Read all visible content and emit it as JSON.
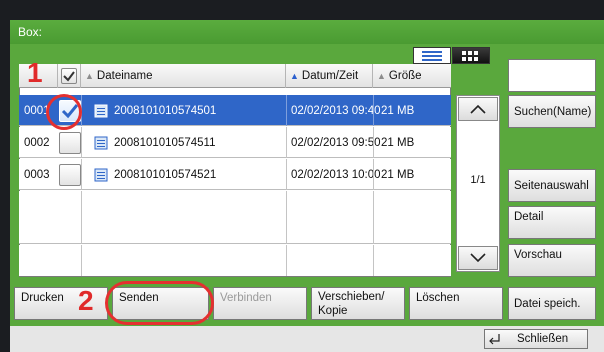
{
  "window": {
    "title": "Box:"
  },
  "columns": {
    "name": "Dateiname",
    "date": "Datum/Zeit",
    "size": "Größe"
  },
  "files": [
    {
      "index": "0001",
      "name": "2008101010574501",
      "date": "02/02/2013 09:40",
      "size": "21  MB",
      "checked": true
    },
    {
      "index": "0002",
      "name": "2008101010574511",
      "date": "02/02/2013 09:50",
      "size": "21  MB",
      "checked": false
    },
    {
      "index": "0003",
      "name": "2008101010574521",
      "date": "02/02/2013 10:00",
      "size": "21  MB",
      "checked": false
    }
  ],
  "pagination": {
    "page": "1/1"
  },
  "right_buttons": {
    "search": "Suchen(Name)",
    "page_select": "Seitenauswahl",
    "detail": "Detail",
    "preview": "Vorschau",
    "save_file": "Datei speich."
  },
  "bottom_buttons": {
    "print": "Drucken",
    "send": "Senden",
    "join": "Verbinden",
    "move_copy_line1": "Verschieben/",
    "move_copy_line2": "Kopie",
    "delete": "Löschen"
  },
  "footer": {
    "close": "Schließen"
  },
  "callouts": {
    "step1": "1",
    "step2": "2"
  },
  "colors": {
    "panel_green": "#5aa83d",
    "selection_blue": "#2f66c8",
    "callout_red": "#e53030"
  }
}
